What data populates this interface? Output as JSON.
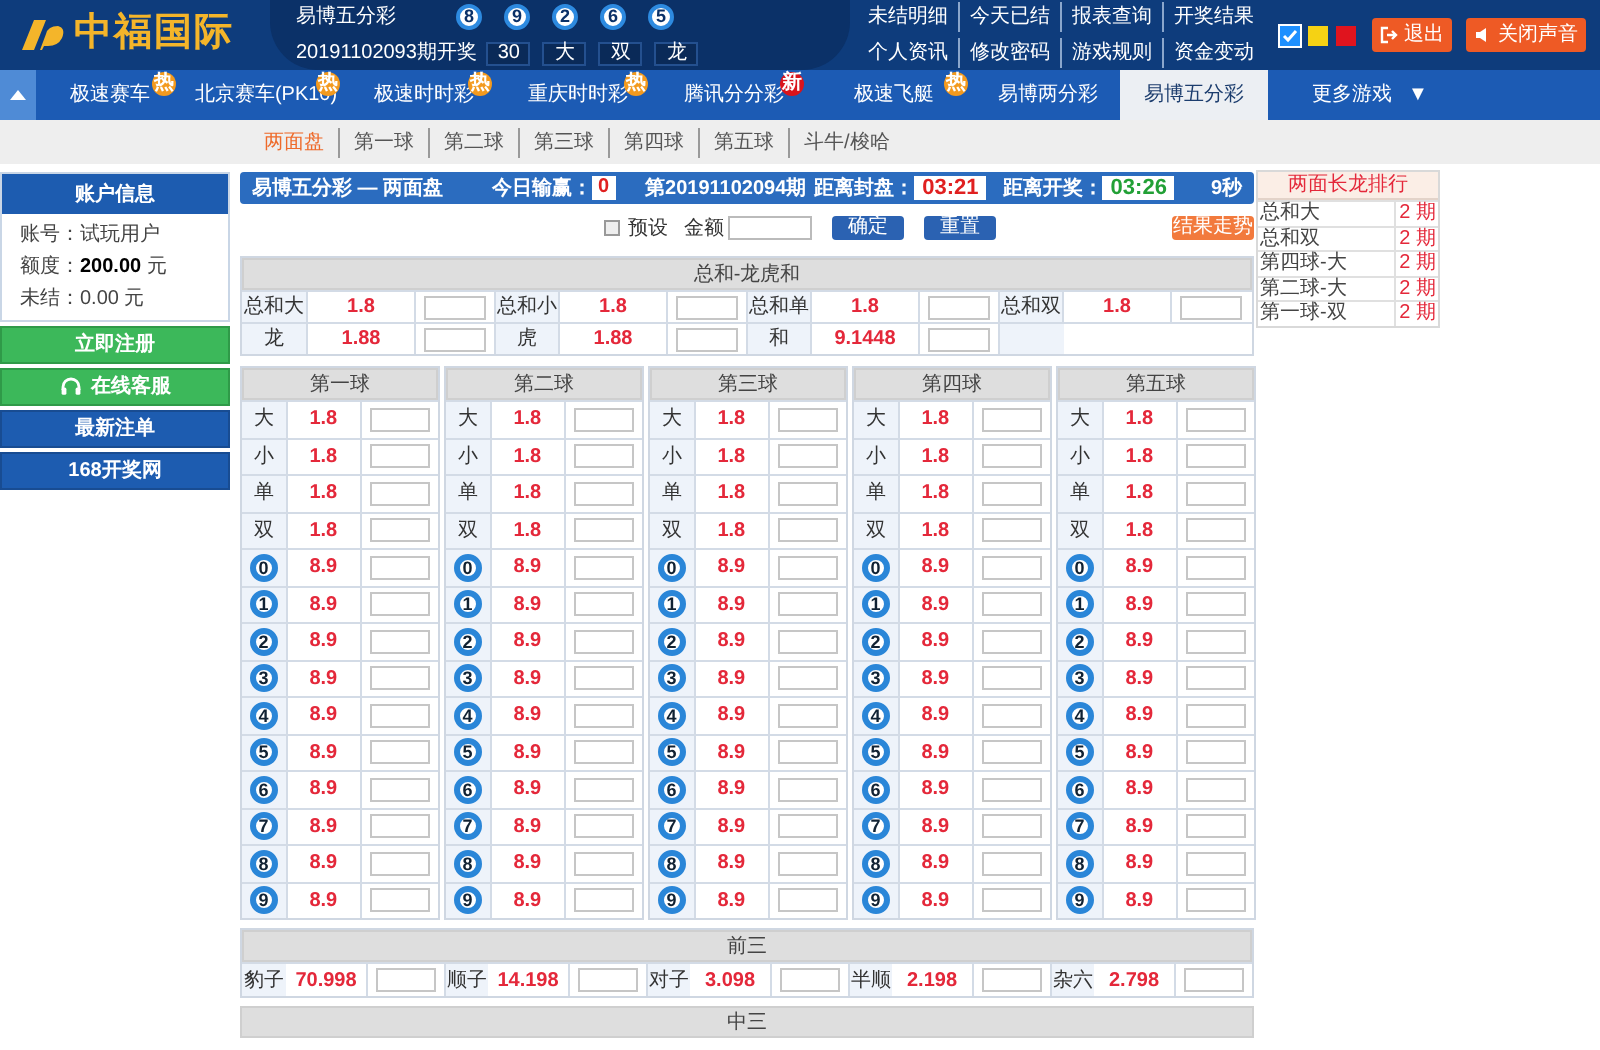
{
  "header": {
    "logo_text": "中福国际",
    "lottery_name": "易博五分彩",
    "balls": [
      "8",
      "9",
      "2",
      "6",
      "5"
    ],
    "period": "20191102093期开奖",
    "result_boxes": [
      "30",
      "大",
      "双",
      "龙"
    ],
    "links": [
      [
        "未结明细",
        "今天已结",
        "报表查询",
        "开奖结果"
      ],
      [
        "个人资讯",
        "修改密码",
        "游戏规则",
        "资金变动"
      ]
    ],
    "swatches": [
      {
        "color": "#1e90ff",
        "selected": true
      },
      {
        "color": "#f5d214",
        "selected": false
      },
      {
        "color": "#e0141e",
        "selected": false
      }
    ],
    "buttons": [
      {
        "label": "退出",
        "kind": "logout"
      },
      {
        "label": "关闭声音",
        "kind": "sound"
      }
    ]
  },
  "nav": {
    "tabs": [
      {
        "label": "极速赛车",
        "selected": false,
        "badge": {
          "text": "热",
          "color": "#f39a1e"
        }
      },
      {
        "label": "北京赛车(PK10)",
        "selected": false,
        "badge": {
          "text": "热",
          "color": "#f39a1e"
        }
      },
      {
        "label": "极速时时彩",
        "selected": false,
        "badge": {
          "text": "热",
          "color": "#f39a1e"
        }
      },
      {
        "label": "重庆时时彩",
        "selected": false,
        "badge": {
          "text": "热",
          "color": "#f39a1e"
        }
      },
      {
        "label": "腾讯分分彩",
        "selected": false,
        "badge": {
          "text": "新",
          "color": "#d9141c"
        }
      },
      {
        "label": "极速飞艇",
        "selected": false,
        "badge": {
          "text": "热",
          "color": "#f39a1e"
        }
      },
      {
        "label": "易博两分彩",
        "selected": false
      },
      {
        "label": "易博五分彩",
        "selected": true
      }
    ],
    "more": "更多游戏",
    "more_caret": "▼"
  },
  "subnav": [
    {
      "label": "两面盘",
      "selected": true
    },
    {
      "label": "第一球",
      "selected": false
    },
    {
      "label": "第二球",
      "selected": false
    },
    {
      "label": "第三球",
      "selected": false
    },
    {
      "label": "第四球",
      "selected": false
    },
    {
      "label": "第五球",
      "selected": false
    },
    {
      "label": "斗牛/梭哈",
      "selected": false
    }
  ],
  "sidebar": {
    "title": "账户信息",
    "info": [
      {
        "label": "账号：",
        "value": "试玩用户",
        "bold": false
      },
      {
        "label": "额度：",
        "value": "200.00",
        "unit": "元",
        "bold": true
      },
      {
        "label": "未结：",
        "value": "0.00",
        "unit": "元",
        "bold": false
      }
    ],
    "buttons": [
      {
        "label": "立即注册",
        "kind": "green"
      },
      {
        "label": "在线客服",
        "kind": "support"
      },
      {
        "label": "最新注单",
        "kind": "blue"
      },
      {
        "label": "168开奖网",
        "kind": "blue"
      }
    ]
  },
  "info_bar": {
    "title": "易博五分彩 — 两面盘",
    "today_label": "今日输赢：",
    "today_value": "0",
    "period": "第20191102094期",
    "close_label": "距离封盘：",
    "close_time": "03:21",
    "open_label": "距离开奖：",
    "open_time": "03:26",
    "seconds": "9秒"
  },
  "options": {
    "preset": {
      "label": "预设",
      "checked": false
    },
    "amount_label": "金额",
    "confirm": "确定",
    "reset": "重置",
    "trend": "结果走势"
  },
  "sum_table": {
    "title": "总和-龙虎和",
    "rows": [
      [
        {
          "label": "总和大",
          "odds": "1.8"
        },
        {
          "label": "总和小",
          "odds": "1.8"
        },
        {
          "label": "总和单",
          "odds": "1.8"
        },
        {
          "label": "总和双",
          "odds": "1.8"
        }
      ],
      [
        {
          "label": "龙",
          "odds": "1.88"
        },
        {
          "label": "虎",
          "odds": "1.88"
        },
        {
          "label": "和",
          "odds": "9.1448"
        }
      ]
    ]
  },
  "ball_columns": [
    {
      "title": "第一球",
      "rows": [
        {
          "kind": "text",
          "label": "大",
          "odds": "1.8"
        },
        {
          "kind": "text",
          "label": "小",
          "odds": "1.8"
        },
        {
          "kind": "text",
          "label": "单",
          "odds": "1.8"
        },
        {
          "kind": "text",
          "label": "双",
          "odds": "1.8"
        },
        {
          "kind": "ball",
          "label": "0",
          "odds": "8.9"
        },
        {
          "kind": "ball",
          "label": "1",
          "odds": "8.9"
        },
        {
          "kind": "ball",
          "label": "2",
          "odds": "8.9"
        },
        {
          "kind": "ball",
          "label": "3",
          "odds": "8.9"
        },
        {
          "kind": "ball",
          "label": "4",
          "odds": "8.9"
        },
        {
          "kind": "ball",
          "label": "5",
          "odds": "8.9"
        },
        {
          "kind": "ball",
          "label": "6",
          "odds": "8.9"
        },
        {
          "kind": "ball",
          "label": "7",
          "odds": "8.9"
        },
        {
          "kind": "ball",
          "label": "8",
          "odds": "8.9"
        },
        {
          "kind": "ball",
          "label": "9",
          "odds": "8.9"
        }
      ]
    },
    {
      "title": "第二球",
      "rows": [
        {
          "kind": "text",
          "label": "大",
          "odds": "1.8"
        },
        {
          "kind": "text",
          "label": "小",
          "odds": "1.8"
        },
        {
          "kind": "text",
          "label": "单",
          "odds": "1.8"
        },
        {
          "kind": "text",
          "label": "双",
          "odds": "1.8"
        },
        {
          "kind": "ball",
          "label": "0",
          "odds": "8.9"
        },
        {
          "kind": "ball",
          "label": "1",
          "odds": "8.9"
        },
        {
          "kind": "ball",
          "label": "2",
          "odds": "8.9"
        },
        {
          "kind": "ball",
          "label": "3",
          "odds": "8.9"
        },
        {
          "kind": "ball",
          "label": "4",
          "odds": "8.9"
        },
        {
          "kind": "ball",
          "label": "5",
          "odds": "8.9"
        },
        {
          "kind": "ball",
          "label": "6",
          "odds": "8.9"
        },
        {
          "kind": "ball",
          "label": "7",
          "odds": "8.9"
        },
        {
          "kind": "ball",
          "label": "8",
          "odds": "8.9"
        },
        {
          "kind": "ball",
          "label": "9",
          "odds": "8.9"
        }
      ]
    },
    {
      "title": "第三球",
      "rows": [
        {
          "kind": "text",
          "label": "大",
          "odds": "1.8"
        },
        {
          "kind": "text",
          "label": "小",
          "odds": "1.8"
        },
        {
          "kind": "text",
          "label": "单",
          "odds": "1.8"
        },
        {
          "kind": "text",
          "label": "双",
          "odds": "1.8"
        },
        {
          "kind": "ball",
          "label": "0",
          "odds": "8.9"
        },
        {
          "kind": "ball",
          "label": "1",
          "odds": "8.9"
        },
        {
          "kind": "ball",
          "label": "2",
          "odds": "8.9"
        },
        {
          "kind": "ball",
          "label": "3",
          "odds": "8.9"
        },
        {
          "kind": "ball",
          "label": "4",
          "odds": "8.9"
        },
        {
          "kind": "ball",
          "label": "5",
          "odds": "8.9"
        },
        {
          "kind": "ball",
          "label": "6",
          "odds": "8.9"
        },
        {
          "kind": "ball",
          "label": "7",
          "odds": "8.9"
        },
        {
          "kind": "ball",
          "label": "8",
          "odds": "8.9"
        },
        {
          "kind": "ball",
          "label": "9",
          "odds": "8.9"
        }
      ]
    },
    {
      "title": "第四球",
      "rows": [
        {
          "kind": "text",
          "label": "大",
          "odds": "1.8"
        },
        {
          "kind": "text",
          "label": "小",
          "odds": "1.8"
        },
        {
          "kind": "text",
          "label": "单",
          "odds": "1.8"
        },
        {
          "kind": "text",
          "label": "双",
          "odds": "1.8"
        },
        {
          "kind": "ball",
          "label": "0",
          "odds": "8.9"
        },
        {
          "kind": "ball",
          "label": "1",
          "odds": "8.9"
        },
        {
          "kind": "ball",
          "label": "2",
          "odds": "8.9"
        },
        {
          "kind": "ball",
          "label": "3",
          "odds": "8.9"
        },
        {
          "kind": "ball",
          "label": "4",
          "odds": "8.9"
        },
        {
          "kind": "ball",
          "label": "5",
          "odds": "8.9"
        },
        {
          "kind": "ball",
          "label": "6",
          "odds": "8.9"
        },
        {
          "kind": "ball",
          "label": "7",
          "odds": "8.9"
        },
        {
          "kind": "ball",
          "label": "8",
          "odds": "8.9"
        },
        {
          "kind": "ball",
          "label": "9",
          "odds": "8.9"
        }
      ]
    },
    {
      "title": "第五球",
      "rows": [
        {
          "kind": "text",
          "label": "大",
          "odds": "1.8"
        },
        {
          "kind": "text",
          "label": "小",
          "odds": "1.8"
        },
        {
          "kind": "text",
          "label": "单",
          "odds": "1.8"
        },
        {
          "kind": "text",
          "label": "双",
          "odds": "1.8"
        },
        {
          "kind": "ball",
          "label": "0",
          "odds": "8.9"
        },
        {
          "kind": "ball",
          "label": "1",
          "odds": "8.9"
        },
        {
          "kind": "ball",
          "label": "2",
          "odds": "8.9"
        },
        {
          "kind": "ball",
          "label": "3",
          "odds": "8.9"
        },
        {
          "kind": "ball",
          "label": "4",
          "odds": "8.9"
        },
        {
          "kind": "ball",
          "label": "5",
          "odds": "8.9"
        },
        {
          "kind": "ball",
          "label": "6",
          "odds": "8.9"
        },
        {
          "kind": "ball",
          "label": "7",
          "odds": "8.9"
        },
        {
          "kind": "ball",
          "label": "8",
          "odds": "8.9"
        },
        {
          "kind": "ball",
          "label": "9",
          "odds": "8.9"
        }
      ]
    }
  ],
  "front_three": {
    "title": "前三",
    "items": [
      {
        "label": "豹子",
        "odds": "70.998"
      },
      {
        "label": "顺子",
        "odds": "14.198"
      },
      {
        "label": "对子",
        "odds": "3.098"
      },
      {
        "label": "半顺",
        "odds": "2.198"
      },
      {
        "label": "杂六",
        "odds": "2.798"
      }
    ]
  },
  "middle_three": {
    "title": "中三"
  },
  "ranking": {
    "title": "两面长龙排行",
    "rows": [
      {
        "name": "总和大",
        "count": "2",
        "unit": "期"
      },
      {
        "name": "总和双",
        "count": "2",
        "unit": "期"
      },
      {
        "name": "第四球-大",
        "count": "2",
        "unit": "期"
      },
      {
        "name": "第二球-大",
        "count": "2",
        "unit": "期"
      },
      {
        "name": "第一球-双",
        "count": "2",
        "unit": "期"
      }
    ]
  }
}
